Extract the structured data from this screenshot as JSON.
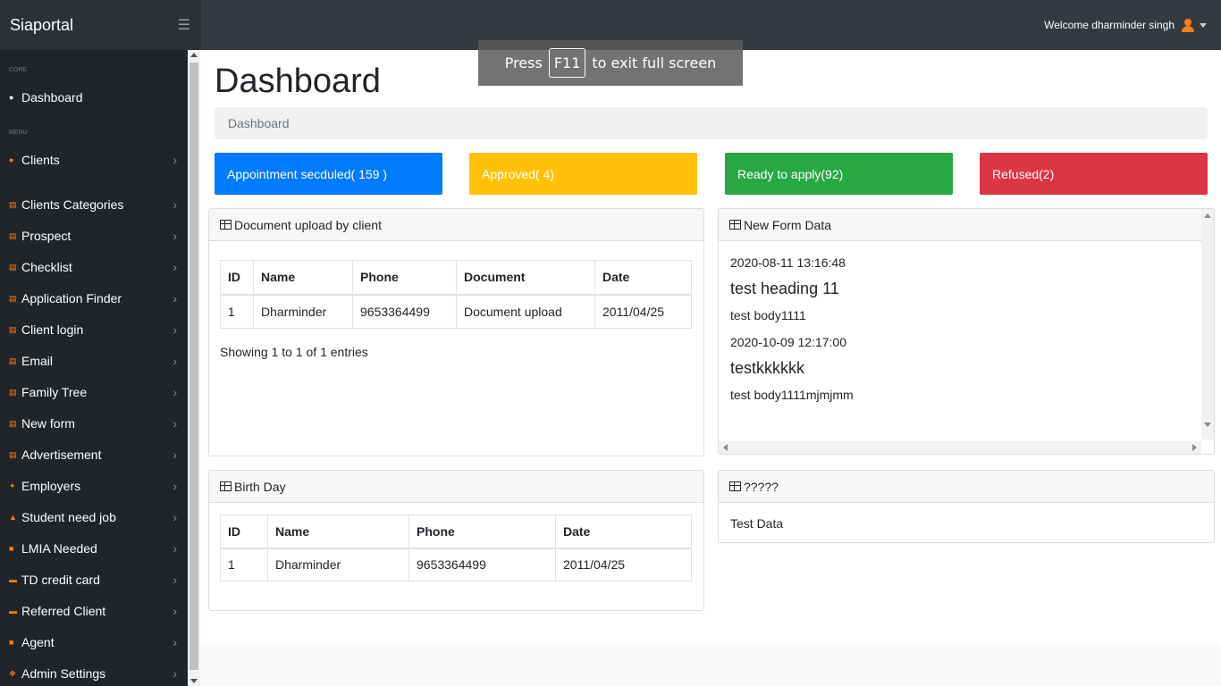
{
  "navbar": {
    "brand": "Siaportal",
    "toggle_icon": "hamburger-icon",
    "welcome": "Welcome dharminder singh"
  },
  "sidebar": {
    "core_heading": "Core",
    "menu_heading": "Menu",
    "dashboard": "Dashboard",
    "items": [
      {
        "label": "Clients",
        "icon": "user-circle-icon"
      },
      {
        "label": "Clients Categories",
        "icon": "columns-icon"
      },
      {
        "label": "Prospect",
        "icon": "columns-icon"
      },
      {
        "label": "Checklist",
        "icon": "columns-icon"
      },
      {
        "label": "Application Finder",
        "icon": "columns-icon"
      },
      {
        "label": "Client login",
        "icon": "columns-icon"
      },
      {
        "label": "Email",
        "icon": "columns-icon"
      },
      {
        "label": "Family Tree",
        "icon": "columns-icon"
      },
      {
        "label": "New form",
        "icon": "columns-icon"
      },
      {
        "label": "Advertisement",
        "icon": "columns-icon"
      },
      {
        "label": "Employers",
        "icon": "handshake-icon"
      },
      {
        "label": "Student need job",
        "icon": "graduation-cap-icon"
      },
      {
        "label": "LMIA Needed",
        "icon": "lock-icon"
      },
      {
        "label": "TD credit card",
        "icon": "credit-card-icon"
      },
      {
        "label": "Referred Client",
        "icon": "credit-card-icon"
      },
      {
        "label": "Agent",
        "icon": "briefcase-icon"
      },
      {
        "label": "Admin Settings",
        "icon": "users-icon"
      }
    ]
  },
  "page": {
    "title": "Dashboard",
    "breadcrumb": "Dashboard"
  },
  "stats": [
    {
      "label": "Appointment secduled( 159 )",
      "color": "#007bff",
      "text_color": "#ffffff"
    },
    {
      "label": "Approved( 4)",
      "color": "#ffc107",
      "text_color": "#ffffff"
    },
    {
      "label": "Ready to apply(92)",
      "color": "#28a745",
      "text_color": "#ffffff"
    },
    {
      "label": "Refused(2)",
      "color": "#dc3545",
      "text_color": "#ffffff"
    }
  ],
  "doc_card": {
    "title": "Document upload by client",
    "columns": [
      "ID",
      "Name",
      "Phone",
      "Document",
      "Date"
    ],
    "rows": [
      [
        "1",
        "Dharminder",
        "9653364499",
        "Document upload",
        "2011/04/25"
      ]
    ],
    "footer": "Showing 1 to 1 of 1 entries"
  },
  "form_card": {
    "title": "New Form Data",
    "entries": [
      {
        "date": "2020-08-11 13:16:48",
        "heading": "test heading 11",
        "body": "test body1111"
      },
      {
        "date": "2020-10-09 12:17:00",
        "heading": "testkkkkkk",
        "body": "test body1111mjmjmm"
      }
    ]
  },
  "birthday_card": {
    "title": "Birth Day",
    "columns": [
      "ID",
      "Name",
      "Phone",
      "Date"
    ],
    "rows": [
      [
        "1",
        "Dharminder",
        "9653364499",
        "2011/04/25"
      ]
    ]
  },
  "misc_card": {
    "title": "?????",
    "body": "Test Data"
  },
  "toast": {
    "press": "Press",
    "key": "F11",
    "rest": "to exit full screen"
  }
}
